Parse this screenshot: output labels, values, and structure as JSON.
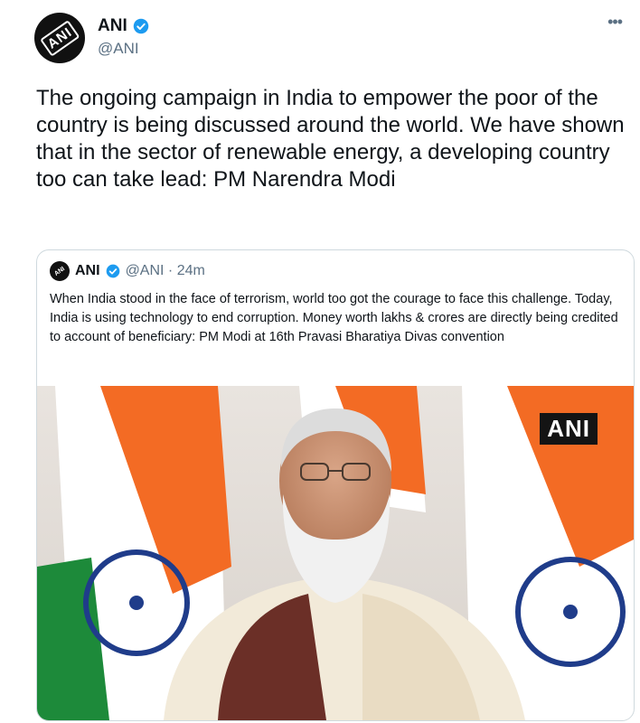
{
  "tweet": {
    "display_name": "ANI",
    "handle": "@ANI",
    "avatar_text": "ANI",
    "more_label": "•••",
    "text": "The ongoing campaign in India to empower the poor of the country is being discussed around the world. We have shown that in the sector of renewable energy, a developing country too can take lead: PM Narendra Modi"
  },
  "quote": {
    "display_name": "ANI",
    "handle_time": "@ANI · 24m",
    "text": "When India stood in the face of terrorism, world too got the courage to face this challenge. Today, India is using technology to end corruption. Money worth lakhs & crores are directly being credited to account of beneficiary: PM Modi at 16th Pravasi Bharatiya Divas convention",
    "media_badge": "ANI"
  },
  "colors": {
    "text": "#0f1419",
    "secondary": "#5b7083",
    "verified": "#1d9bf0",
    "border": "#cfd9de",
    "saffron": "#f36b24",
    "green": "#1d8a3a",
    "chakra": "#1f3c8a"
  },
  "icons": {
    "verified": "verified-badge-icon",
    "more": "more-options-icon"
  }
}
